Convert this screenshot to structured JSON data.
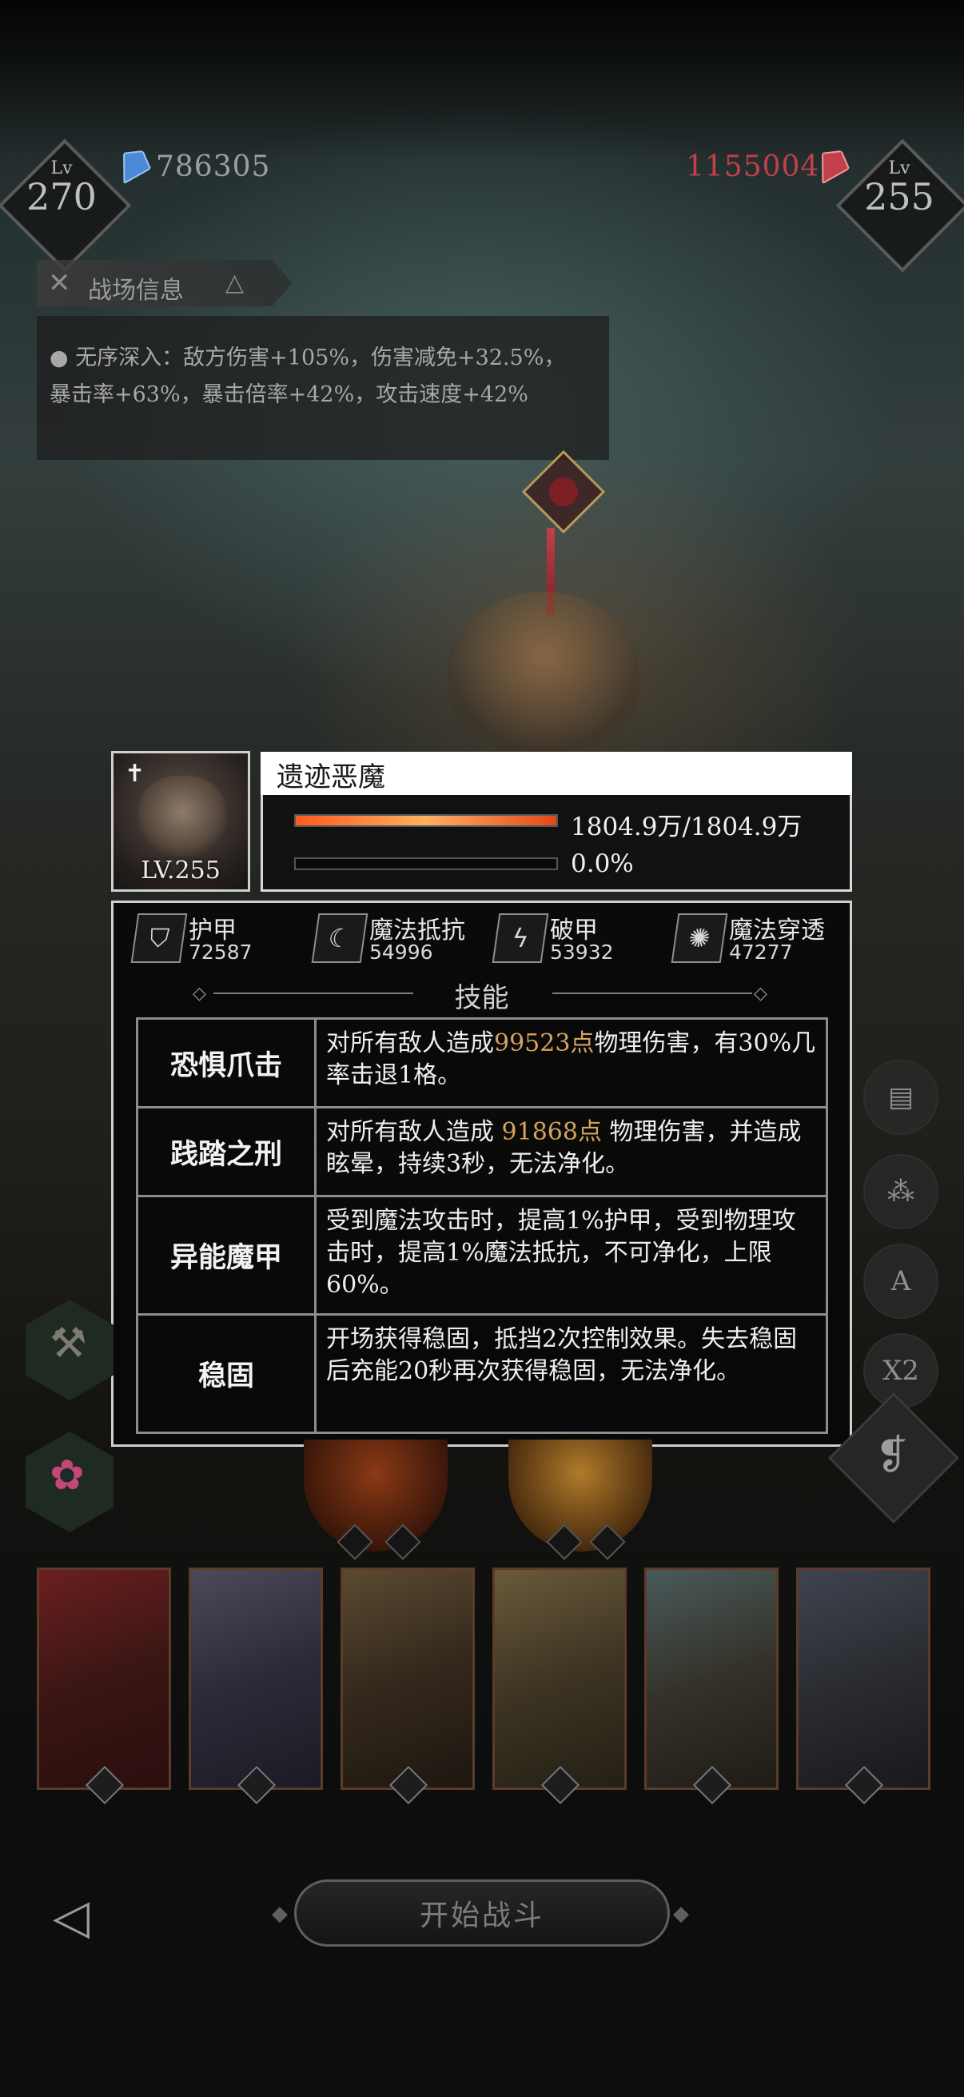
{
  "hud": {
    "player_level_label": "Lv",
    "player_level": "270",
    "player_power": "786305",
    "enemy_power": "1155004",
    "enemy_level_label": "Lv",
    "enemy_level": "255"
  },
  "battlefield": {
    "title": "战场信息",
    "effect_text": "无序深入：敌方伤害+105%，伤害减免+32.5%，暴击率+63%，暴击倍率+42%，攻击速度+42%"
  },
  "boss": {
    "name": "遗迹恶魔",
    "level": "LV.255",
    "hp_text": "1804.9万/1804.9万",
    "hp_fraction": 1.0,
    "energy_text": "0.0%",
    "energy_fraction": 0.0
  },
  "stats": [
    {
      "label": "护甲",
      "value": "72587",
      "icon": "shield-icon"
    },
    {
      "label": "魔法抵抗",
      "value": "54996",
      "icon": "magic-resist-icon"
    },
    {
      "label": "破甲",
      "value": "53932",
      "icon": "armor-break-icon"
    },
    {
      "label": "魔法穿透",
      "value": "47277",
      "icon": "magic-pierce-icon"
    }
  ],
  "skills_title": "技能",
  "skills": [
    {
      "name": "恐惧爪击",
      "pre": "对所有敌人造成",
      "hl": "99523点",
      "post": "物理伤害，有30%几率击退1格。"
    },
    {
      "name": "践踏之刑",
      "pre": "对所有敌人造成 ",
      "hl": "91868点",
      "post": " 物理伤害，并造成眩晕，持续3秒，无法净化。"
    },
    {
      "name": "异能魔甲",
      "pre": "受到魔法攻击时，提高1%护甲，受到物理攻击时，提高1%魔法抵抗，不可净化，上限60%。",
      "hl": "",
      "post": ""
    },
    {
      "name": "稳固",
      "pre": "开场获得稳固，抵挡2次控制效果。失去稳固后充能20秒再次获得稳固，无法净化。",
      "hl": "",
      "post": ""
    }
  ],
  "side_buttons": {
    "auto_label": "A",
    "speed_label": "X2"
  },
  "start_button": "开始战斗",
  "colors": {
    "hp_bar": "#ff7a36",
    "highlight": "#d6a25c",
    "enemy_red": "#c2404a",
    "player_blue": "#4a8ad6"
  }
}
